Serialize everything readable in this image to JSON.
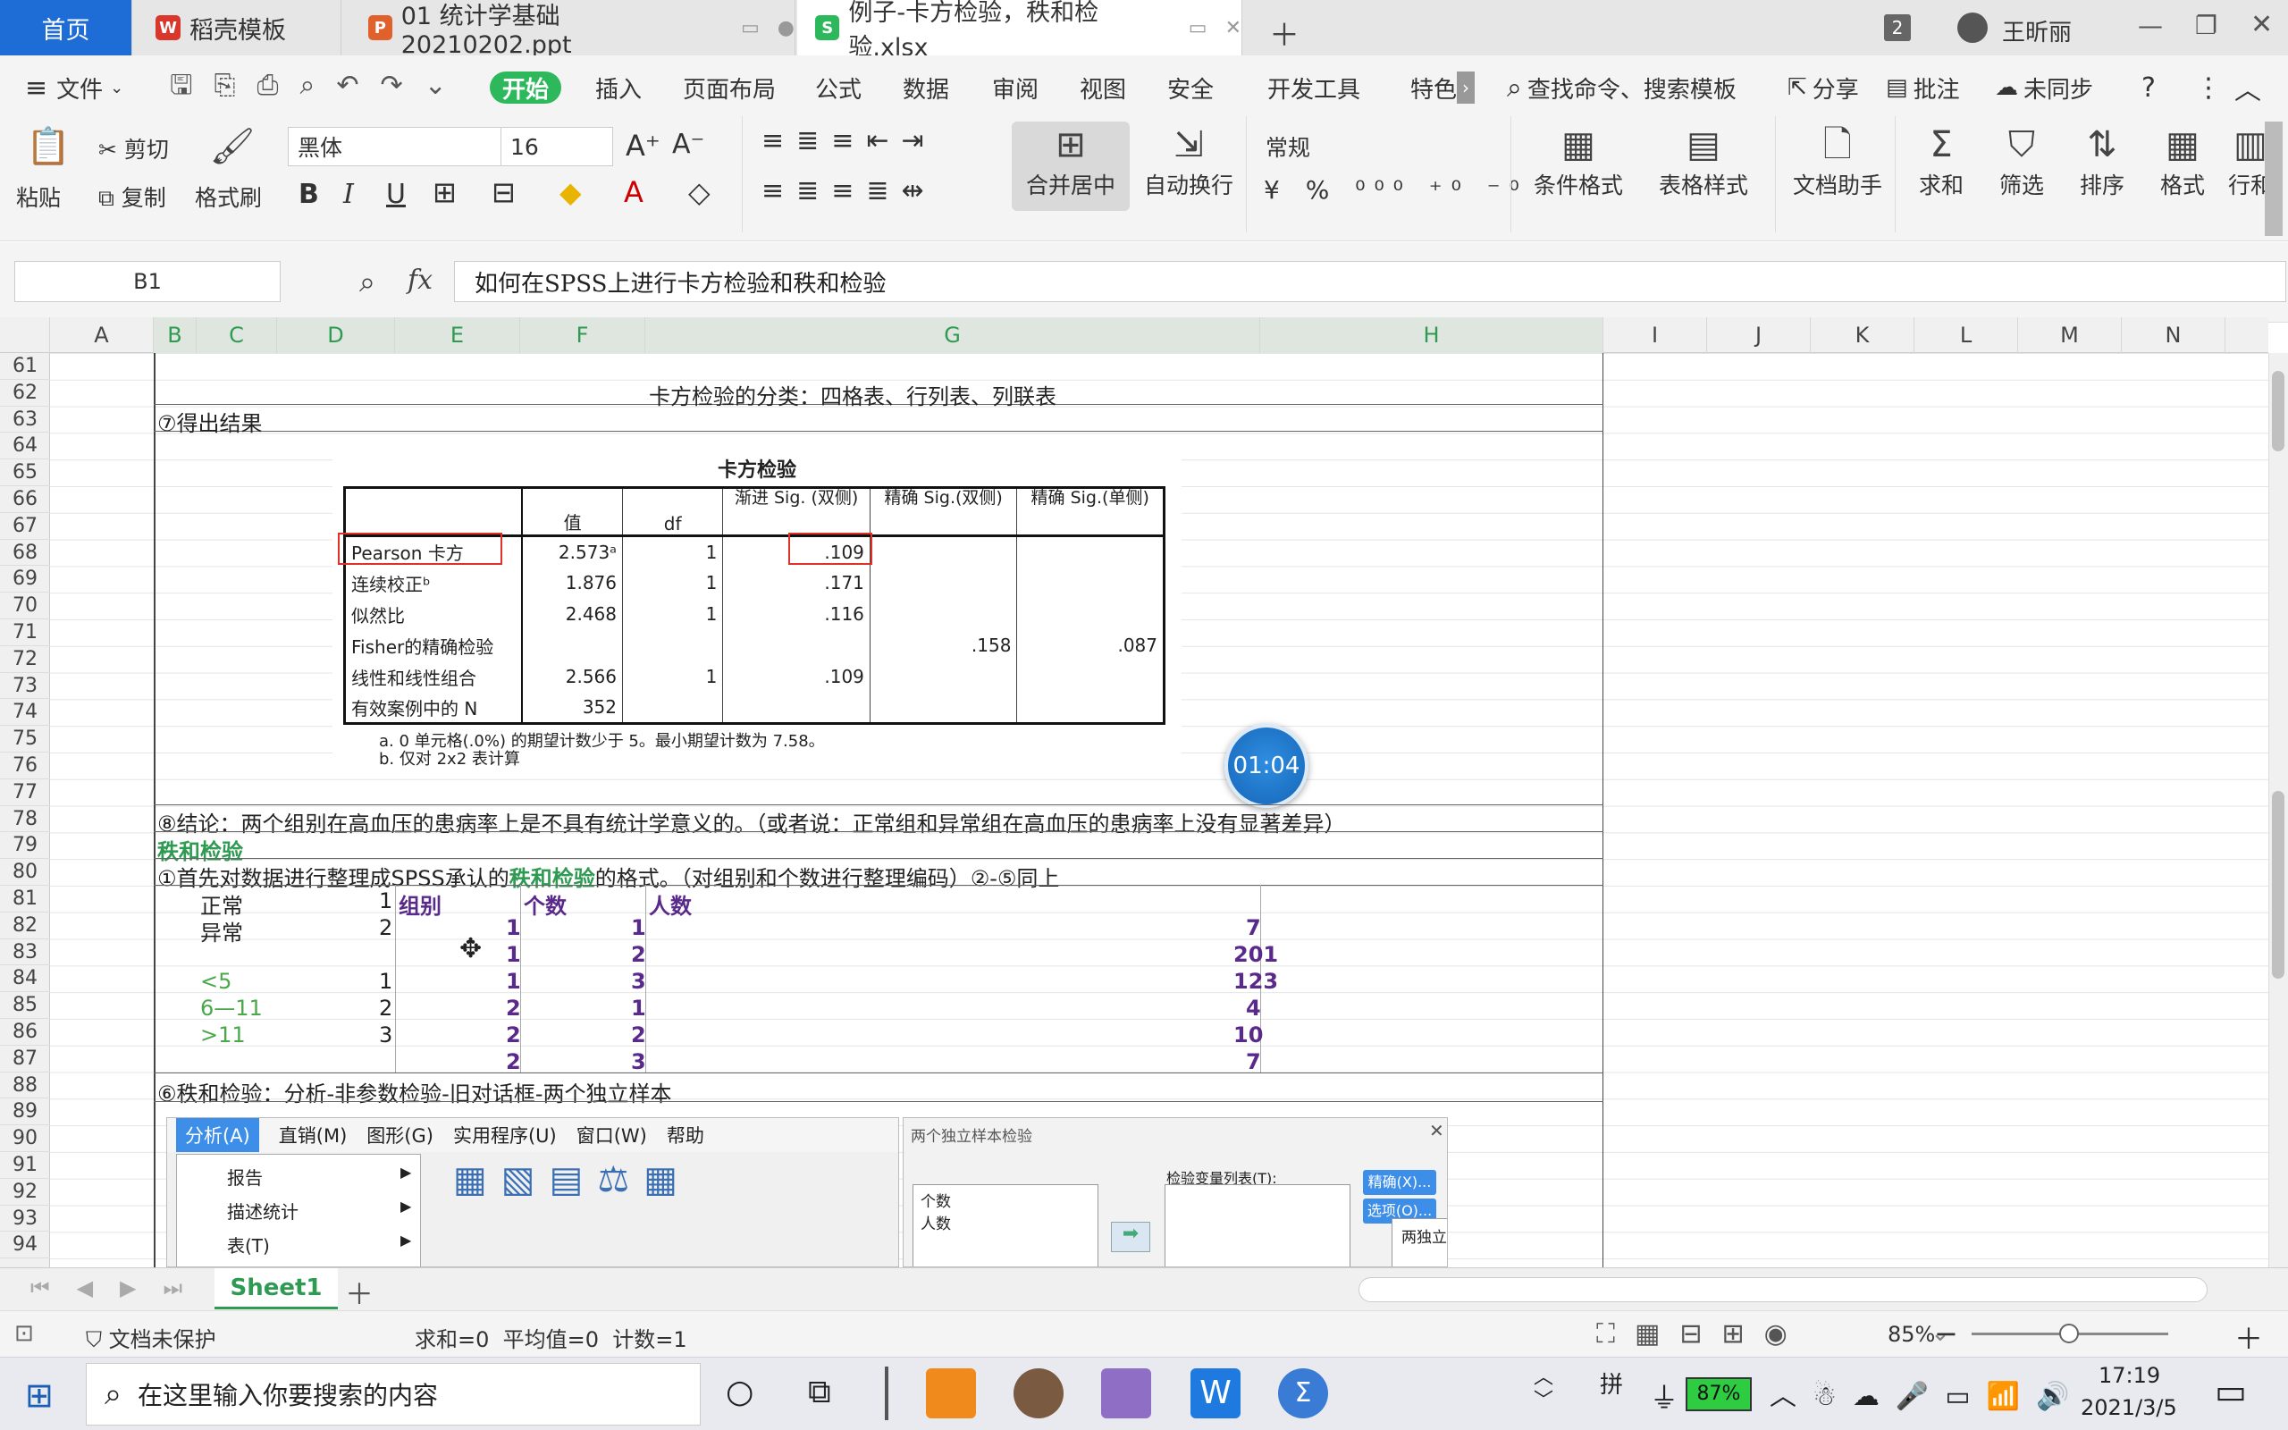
{
  "tabs": {
    "home": "首页",
    "template": "稻壳模板",
    "ppt": "01 统计学基础 20210202.ppt",
    "xlsx": "例子-卡方检验，秩和检验.xlsx",
    "count": "2",
    "user": "王昕丽"
  },
  "menu": {
    "file": "文件",
    "start": "开始",
    "insert": "插入",
    "layout": "页面布局",
    "formula": "公式",
    "data": "数据",
    "review": "审阅",
    "view": "视图",
    "security": "安全",
    "dev": "开发工具",
    "special": "特色",
    "search": "查找命令、搜索模板",
    "share": "分享",
    "comment": "批注",
    "sync": "未同步"
  },
  "ribbon": {
    "paste": "粘贴",
    "cut": "剪切",
    "copy": "复制",
    "format_painter": "格式刷",
    "font": "黑体",
    "size": "16",
    "merge": "合并居中",
    "wrap": "自动换行",
    "numfmt": "常规",
    "cond": "条件格式",
    "tablestyle": "表格样式",
    "docassist": "文档助手",
    "sum": "求和",
    "filter": "筛选",
    "sort": "排序",
    "format": "格式",
    "rowcol": "行和"
  },
  "formula_bar": {
    "cellref": "B1",
    "fx": "fx",
    "content": "如何在SPSS上进行卡方检验和秩和检验"
  },
  "columns": [
    "A",
    "B",
    "C",
    "D",
    "E",
    "F",
    "G",
    "H",
    "I",
    "J",
    "K",
    "L",
    "M",
    "N"
  ],
  "rows": [
    "61",
    "62",
    "63",
    "64",
    "65",
    "66",
    "67",
    "68",
    "69",
    "70",
    "71",
    "72",
    "73",
    "74",
    "75",
    "76",
    "77",
    "78",
    "79",
    "80",
    "81",
    "82",
    "83",
    "84",
    "85",
    "86",
    "87",
    "88",
    "89",
    "90",
    "91",
    "92",
    "93",
    "94"
  ],
  "cells": {
    "r62": "卡方检验的分类：四格表、行列表、列联表",
    "r63": "⑦得出结果",
    "r78": "⑧结论：两个组别在高血压的患病率上是不具有统计学意义的。（或者说：正常组和异常组在高血压的患病率上没有显著差异）",
    "r79": "秩和检验",
    "r80a": "①首先对数据进行整理成SPSS承认的",
    "r80b": "秩和检验",
    "r80c": "的格式。（对组别和个数进行整理编码）②-⑤同上",
    "r88": "⑥秩和检验：分析-非参数检验-旧对话框-两个独立样本"
  },
  "data_table": {
    "headers": [
      "组别",
      "个数",
      "人数"
    ],
    "labels": [
      [
        "正常",
        "1"
      ],
      [
        "异常",
        "2"
      ],
      [
        "",
        ""
      ],
      [
        "<5",
        "1"
      ],
      [
        "6—11",
        "2"
      ],
      [
        ">11",
        "3"
      ]
    ],
    "rows": [
      [
        "1",
        "1",
        "7"
      ],
      [
        "1",
        "2",
        "201"
      ],
      [
        "1",
        "3",
        "123"
      ],
      [
        "2",
        "1",
        "4"
      ],
      [
        "2",
        "2",
        "10"
      ],
      [
        "2",
        "3",
        "7"
      ]
    ]
  },
  "spss": {
    "title": "卡方检验",
    "headers": [
      "",
      "值",
      "df",
      "渐进 Sig. (双侧)",
      "精确 Sig.(双侧)",
      "精确 Sig.(单侧)"
    ],
    "rows": [
      [
        "Pearson 卡方",
        "2.573ᵃ",
        "1",
        ".109",
        "",
        ""
      ],
      [
        "连续校正ᵇ",
        "1.876",
        "1",
        ".171",
        "",
        ""
      ],
      [
        "似然比",
        "2.468",
        "1",
        ".116",
        "",
        ""
      ],
      [
        "Fisher的精确检验",
        "",
        "",
        "",
        ".158",
        ".087"
      ],
      [
        "线性和线性组合",
        "2.566",
        "1",
        ".109",
        "",
        ""
      ],
      [
        "有效案例中的 N",
        "352",
        "",
        "",
        "",
        ""
      ]
    ],
    "notes": [
      "a. 0 单元格(.0%) 的期望计数少于 5。最小期望计数为 7.58。",
      "b. 仅对 2x2 表计算"
    ]
  },
  "embed": {
    "menus": [
      "分析(A)",
      "直销(M)",
      "图形(G)",
      "实用程序(U)",
      "窗口(W)",
      "帮助"
    ],
    "items": [
      "报告",
      "描述统计",
      "表(T)"
    ],
    "dialog_title": "两个独立样本检验",
    "vars": [
      "个数",
      "人数"
    ],
    "testvar": "检验变量列表(T):",
    "exact": "精确(X)...",
    "options": "选项(O)...",
    "sub": "两独立样本: 定..."
  },
  "timer": "01:04",
  "sheet": "Sheet1",
  "status": {
    "protect": "文档未保护",
    "summary": "求和=0  平均值=0  计数=1",
    "zoom": "85%"
  },
  "taskbar": {
    "search": "在这里输入你要搜索的内容",
    "battery": "87%",
    "ime": "拼",
    "time": "17:19",
    "date": "2021/3/5"
  }
}
